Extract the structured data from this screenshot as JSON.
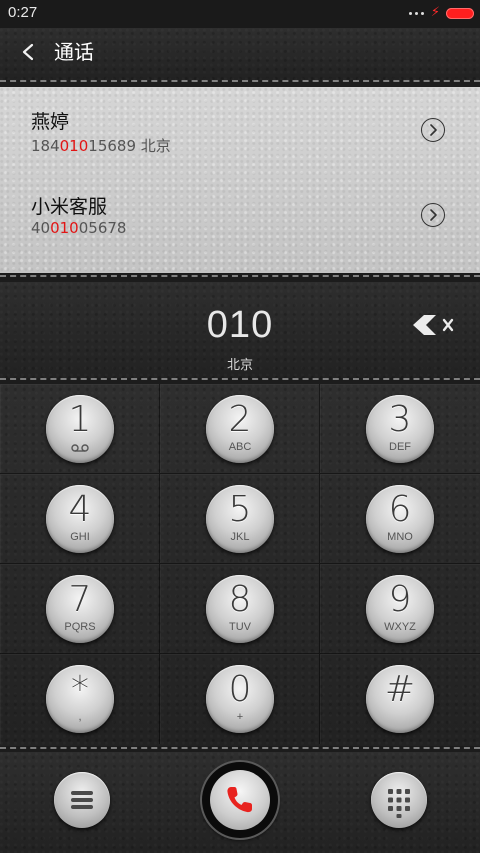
{
  "status_bar": {
    "time": "0:27"
  },
  "header": {
    "title": "通话"
  },
  "contacts": [
    {
      "name": "燕婷",
      "number_pre": "184",
      "number_match": "010",
      "number_post": "15689",
      "location": "北京"
    },
    {
      "name": "小米客服",
      "number_pre": "40",
      "number_match": "010",
      "number_post": "05678",
      "location": ""
    }
  ],
  "dialer": {
    "number": "010",
    "location": "北京"
  },
  "keys": [
    {
      "digit": "1",
      "letters": ""
    },
    {
      "digit": "2",
      "letters": "ABC"
    },
    {
      "digit": "3",
      "letters": "DEF"
    },
    {
      "digit": "4",
      "letters": "GHI"
    },
    {
      "digit": "5",
      "letters": "JKL"
    },
    {
      "digit": "6",
      "letters": "MNO"
    },
    {
      "digit": "7",
      "letters": "PQRS"
    },
    {
      "digit": "8",
      "letters": "TUV"
    },
    {
      "digit": "9",
      "letters": "WXYZ"
    },
    {
      "digit": "*",
      "letters": ","
    },
    {
      "digit": "0",
      "letters": "+"
    },
    {
      "digit": "#",
      "letters": ""
    }
  ],
  "icons": {
    "back": "chevron-left-icon",
    "detail": "chevron-right-circle-icon",
    "backspace": "backspace-icon",
    "voicemail": "voicemail-icon",
    "menu": "menu-icon",
    "call": "phone-icon",
    "dialpad": "dialpad-icon"
  },
  "colors": {
    "highlight": "#e21515",
    "call_icon": "#e8231f",
    "battery": "#ff1f1f"
  }
}
